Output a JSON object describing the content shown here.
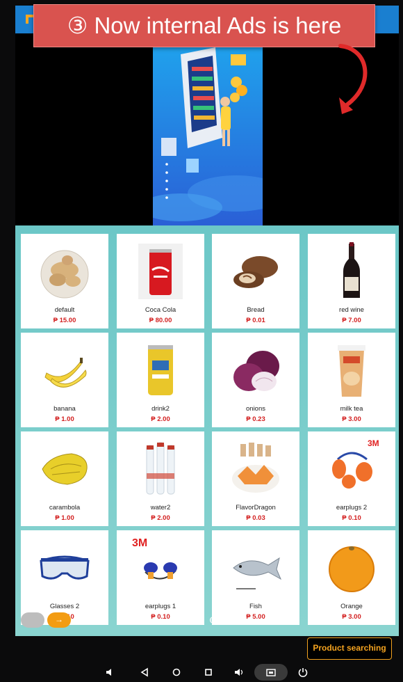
{
  "banner": {
    "text": "③ Now internal Ads is here"
  },
  "topbar": {
    "logo_text": "Me"
  },
  "products": [
    {
      "name": "default",
      "price": "₱ 15.00",
      "icon": "ginger"
    },
    {
      "name": "Coca Cola",
      "price": "₱ 80.00",
      "icon": "coca-cola-can"
    },
    {
      "name": "Bread",
      "price": "₱ 0.01",
      "icon": "bread"
    },
    {
      "name": "red wine",
      "price": "₱ 7.00",
      "icon": "wine-bottle"
    },
    {
      "name": "banana",
      "price": "₱ 1.00",
      "icon": "banana"
    },
    {
      "name": "drink2",
      "price": "₱ 2.00",
      "icon": "drink-can"
    },
    {
      "name": "onions",
      "price": "₱ 0.23",
      "icon": "onion"
    },
    {
      "name": "milk tea",
      "price": "₱ 3.00",
      "icon": "milk-tea-cup"
    },
    {
      "name": "carambola",
      "price": "₱ 1.00",
      "icon": "star-fruit"
    },
    {
      "name": "water2",
      "price": "₱ 2.00",
      "icon": "water-bottles"
    },
    {
      "name": "FlavorDragon",
      "price": "₱ 0.03",
      "icon": "snack-plate"
    },
    {
      "name": "earplugs 2",
      "price": "₱ 0.10",
      "icon": "earplugs-orange",
      "brand": "3M"
    },
    {
      "name": "Glasses 2",
      "price": "₱ 0.10",
      "icon": "safety-glasses"
    },
    {
      "name": "earplugs 1",
      "price": "₱ 0.10",
      "icon": "earplugs-blue",
      "brand": "3M"
    },
    {
      "name": "Fish",
      "price": "₱ 5.00",
      "icon": "fish"
    },
    {
      "name": "Orange",
      "price": "₱ 3.00",
      "icon": "orange"
    }
  ],
  "pager": {
    "next_label": "→",
    "pages": 2,
    "current": 1
  },
  "search": {
    "label": "Product searching"
  },
  "colors": {
    "accent": "#f3a21f",
    "price": "#d32020",
    "grid_bg": "#6cc7c7",
    "banner": "#d9534f",
    "topbar": "#1a7fd0"
  }
}
